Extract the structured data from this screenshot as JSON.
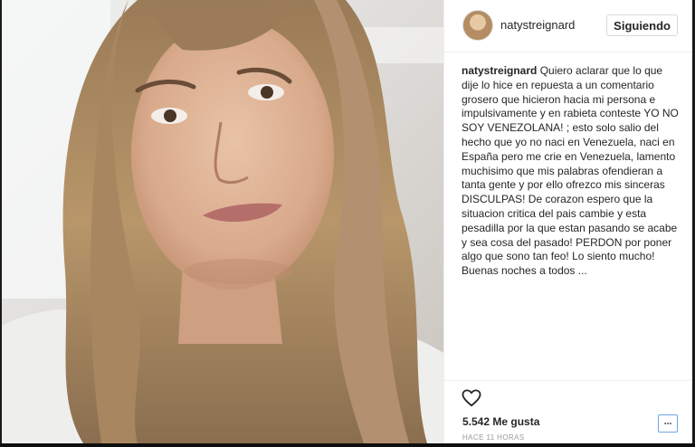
{
  "post": {
    "username": "natystreignard",
    "follow_label": "Siguiendo",
    "caption_author": "natystreignard",
    "caption_text": " Quiero aclarar que lo que dije lo hice en repuesta a un comentario grosero que hicieron hacia mi persona e impulsivamente y en rabieta conteste YO NO SOY VENEZOLANA! ; esto solo salio del hecho que yo no naci en Venezuela, naci en España pero me crie en Venezuela, lamento muchisimo que mis palabras ofendieran a tanta gente y por ello ofrezco mis sinceras DISCULPAS! De corazon espero que la situacion critica del pais cambie y esta pesadilla por la que estan pasando se acabe y sea cosa del pasado! PERDON por poner algo que sono tan feo! Lo siento mucho! Buenas noches a todos ...",
    "likes": "5.542 Me gusta",
    "timestamp": "HACE 11 HORAS"
  },
  "icons": {
    "like": "heart-outline-icon",
    "more": "more-options-icon"
  },
  "colors": {
    "text": "#262626",
    "muted": "#999999",
    "border": "#efefef",
    "focus": "#6ea6e0"
  }
}
